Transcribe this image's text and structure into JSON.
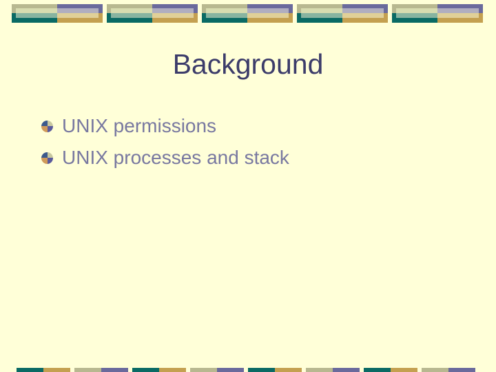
{
  "slide": {
    "title": "Background",
    "bullets": [
      {
        "icon": "quartered-circle-bullet-icon",
        "text": "UNIX permissions"
      },
      {
        "icon": "quartered-circle-bullet-icon",
        "text": "UNIX processes and stack"
      }
    ]
  },
  "theme": {
    "background": "#ffffd8",
    "title_color": "#3c3c6a",
    "bullet_text_color": "#7878a0",
    "accent_colors": {
      "teal": "#0a6a64",
      "gold": "#c4a050",
      "olive": "#b8b890",
      "purple": "#6a6a9c"
    }
  }
}
